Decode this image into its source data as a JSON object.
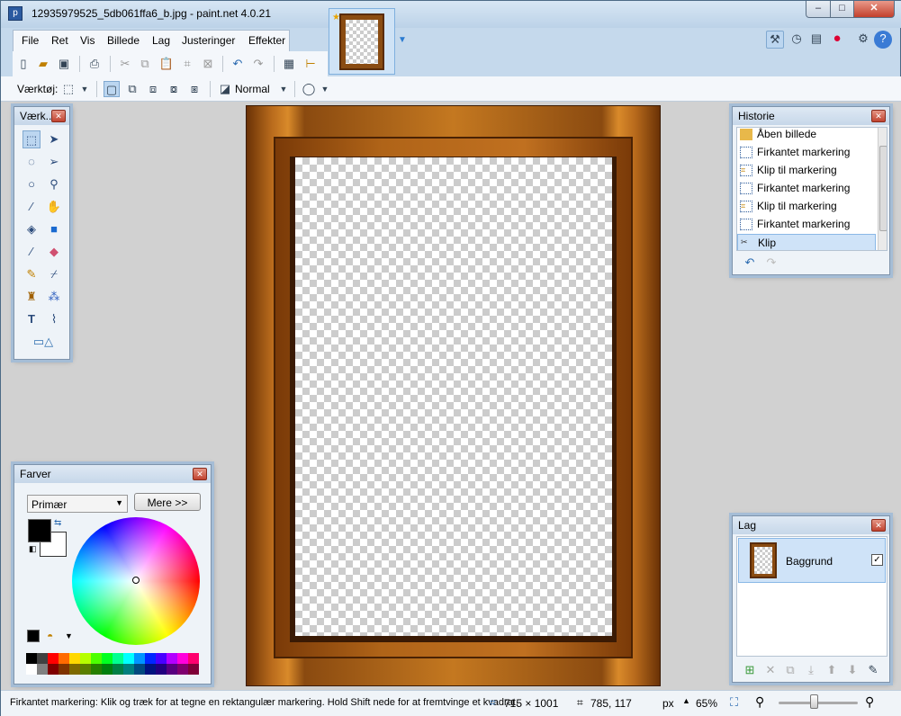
{
  "window": {
    "title": "12935979525_5db061ffa6_b.jpg - paint.net 4.0.21",
    "min": "–",
    "max": "□",
    "close": "✕"
  },
  "menu": [
    "File",
    "Ret",
    "Vis",
    "Billede",
    "Lag",
    "Justeringer",
    "Effekter"
  ],
  "toolbar2": {
    "tool_label": "Værktøj:",
    "blend_mode": "Normal"
  },
  "tools_panel": {
    "title": "Værk..."
  },
  "history": {
    "title": "Historie",
    "items": [
      "Åben billede",
      "Firkantet markering",
      "Klip til markering",
      "Firkantet markering",
      "Klip til markering",
      "Firkantet markering",
      "Klip"
    ],
    "selected_index": 6
  },
  "colors": {
    "title": "Farver",
    "dropdown": "Primær",
    "more_button": "Mere >>",
    "palette": [
      "#000000",
      "#404040",
      "#ff0000",
      "#ff6a00",
      "#ffd800",
      "#b6ff00",
      "#4cff00",
      "#00ff21",
      "#00ff90",
      "#00ffff",
      "#0094ff",
      "#0026ff",
      "#4800ff",
      "#b200ff",
      "#ff00dc",
      "#ff006e",
      "#ffffff",
      "#808080",
      "#7f0000",
      "#7f3300",
      "#7f6a00",
      "#5b7f00",
      "#267f00",
      "#007f0e",
      "#007f46",
      "#007f7f",
      "#004a7f",
      "#00137f",
      "#21007f",
      "#57007f",
      "#7f006e",
      "#7f0037"
    ]
  },
  "layers": {
    "title": "Lag",
    "layer_name": "Baggrund",
    "visible": true
  },
  "status": {
    "hint": "Firkantet markering: Klik og træk for at tegne en rektangulær markering. Hold Shift nede for at fremtvinge et kvadrat.",
    "selection_size": "715 × 1001",
    "cursor_pos": "785, 117",
    "unit": "px",
    "zoom": "65%"
  },
  "colors_hex": {
    "accent": "#3a7bd5",
    "frame_wood": "#b86a1c"
  }
}
